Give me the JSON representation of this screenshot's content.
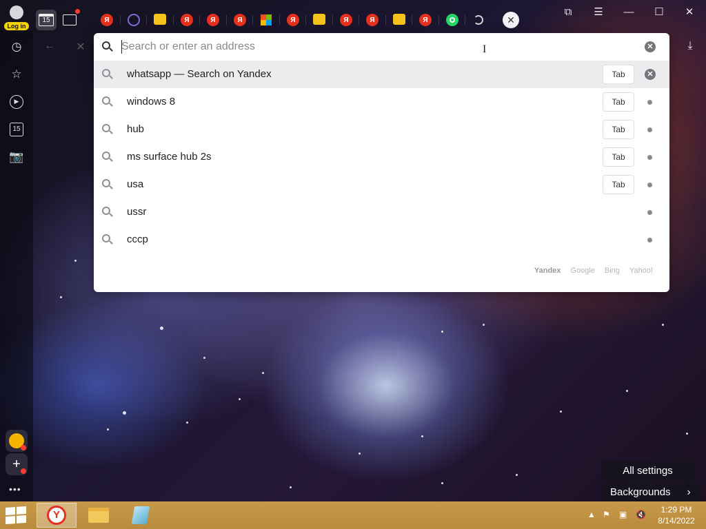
{
  "browser": {
    "login_label": "Log in",
    "tab_counter": "15",
    "tabs": [
      {
        "icon": "yandex-icon",
        "glyph": "Я"
      },
      {
        "icon": "viber-icon",
        "glyph": ""
      },
      {
        "icon": "image-icon",
        "glyph": ""
      },
      {
        "icon": "yandex-icon",
        "glyph": "Я"
      },
      {
        "icon": "yandex-icon",
        "glyph": "Я"
      },
      {
        "icon": "yandex-icon",
        "glyph": "Я"
      },
      {
        "icon": "microsoft-icon",
        "glyph": ""
      },
      {
        "icon": "yandex-icon",
        "glyph": "Я"
      },
      {
        "icon": "image-icon",
        "glyph": ""
      },
      {
        "icon": "yandex-icon",
        "glyph": "Я"
      },
      {
        "icon": "yandex-icon",
        "glyph": "Я"
      },
      {
        "icon": "image-icon",
        "glyph": ""
      },
      {
        "icon": "yandex-icon",
        "glyph": "Я"
      },
      {
        "icon": "whatsapp-icon",
        "glyph": ""
      },
      {
        "icon": "loading-icon",
        "glyph": ""
      }
    ],
    "sidebar_counter": "15"
  },
  "omnibox": {
    "placeholder": "Search or enter an address",
    "value": ""
  },
  "suggestions": [
    {
      "text": "whatsapp — Search on Yandex",
      "tab_label": "Tab",
      "selected": true
    },
    {
      "text": "windows 8",
      "tab_label": "Tab",
      "selected": false
    },
    {
      "text": "hub",
      "tab_label": "Tab",
      "selected": false
    },
    {
      "text": "ms surface hub 2s",
      "tab_label": "Tab",
      "selected": false
    },
    {
      "text": "usa",
      "tab_label": "Tab",
      "selected": false
    },
    {
      "text": "ussr",
      "tab_label": "",
      "selected": false
    },
    {
      "text": "cccp",
      "tab_label": "",
      "selected": false
    }
  ],
  "search_engines": {
    "current": "Yandex",
    "others": [
      "Google",
      "Bing",
      "Yahoo!"
    ]
  },
  "newtab": {
    "all_settings": "All settings",
    "backgrounds": "Backgrounds"
  },
  "taskbar": {
    "time": "1:29 PM",
    "date": "8/14/2022"
  },
  "colors": {
    "accent_red": "#e5301e",
    "taskbar": "#c79a4a",
    "login_badge": "#f5d400"
  }
}
